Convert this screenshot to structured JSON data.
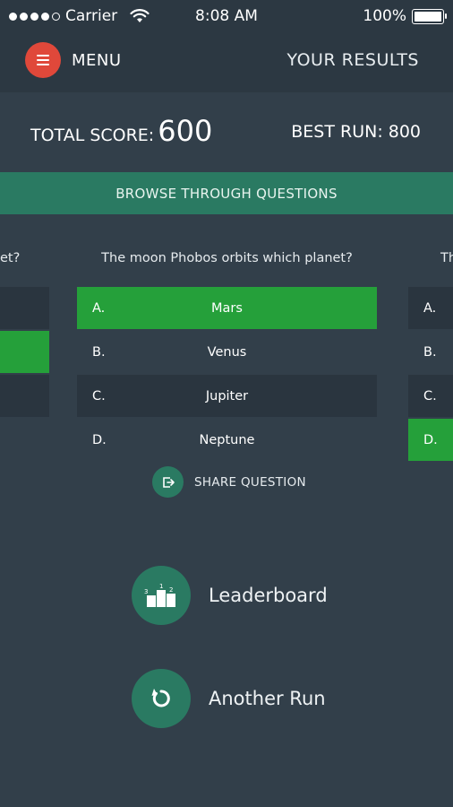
{
  "status_bar": {
    "carrier": "Carrier",
    "time": "8:08 AM",
    "battery": "100%"
  },
  "header": {
    "menu_label": "MENU",
    "results_label": "YOUR RESULTS"
  },
  "score": {
    "total_label": "TOTAL SCORE:",
    "total_value": "600",
    "best_label": "BEST RUN:",
    "best_value": "800"
  },
  "browse_label": "BROWSE THROUGH QUESTIONS",
  "carousel": {
    "prev_question_fragment": "et?",
    "next_question_fragment": "Th",
    "current": {
      "question": "The moon Phobos orbits which planet?",
      "answers": [
        {
          "letter": "A.",
          "text": "Mars",
          "state": "correct"
        },
        {
          "letter": "B.",
          "text": "Venus",
          "state": "plain"
        },
        {
          "letter": "C.",
          "text": "Jupiter",
          "state": "dark"
        },
        {
          "letter": "D.",
          "text": "Neptune",
          "state": "plain"
        }
      ]
    },
    "next_answer_letters": [
      "A.",
      "B.",
      "C.",
      "D."
    ]
  },
  "share_label": "SHARE QUESTION",
  "actions": {
    "leaderboard": "Leaderboard",
    "another_run": "Another Run"
  },
  "colors": {
    "background": "#323f4a",
    "header": "#2c3842",
    "accent_green": "#2a7a62",
    "correct": "#25a03a",
    "menu_red": "#e0483a"
  }
}
